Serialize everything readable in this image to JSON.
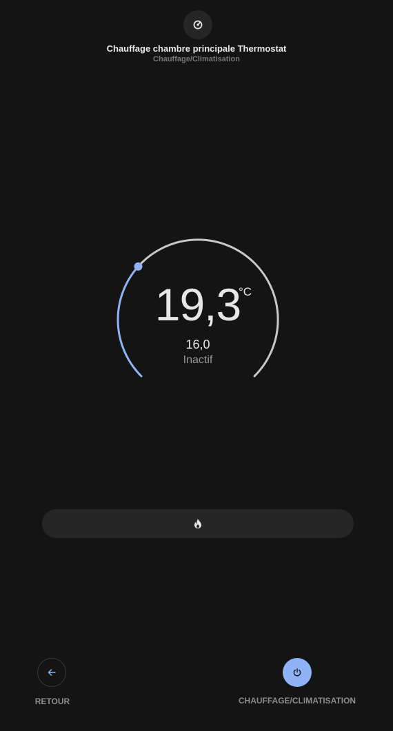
{
  "header": {
    "icon": "thermostat-icon",
    "title": "Chauffage chambre principale Thermostat",
    "subtitle": "Chauffage/Climatisation"
  },
  "thermostat": {
    "current_temperature": "19,3",
    "unit": "°C",
    "target_temperature": "16,0",
    "action": "Inactif",
    "range_min": 7,
    "range_max": 35,
    "target_value": 16.0,
    "colors": {
      "active_arc": "#8fb3f5",
      "inactive_arc": "#c8c8c8"
    }
  },
  "modes": {
    "selected_icon": "flame-icon"
  },
  "footer": {
    "back_label": "RETOUR",
    "back_icon": "arrow-left-icon",
    "power_label": "CHAUFFAGE/CLIMATISATION",
    "power_icon": "power-icon",
    "accent_color": "#8fb3f5"
  }
}
